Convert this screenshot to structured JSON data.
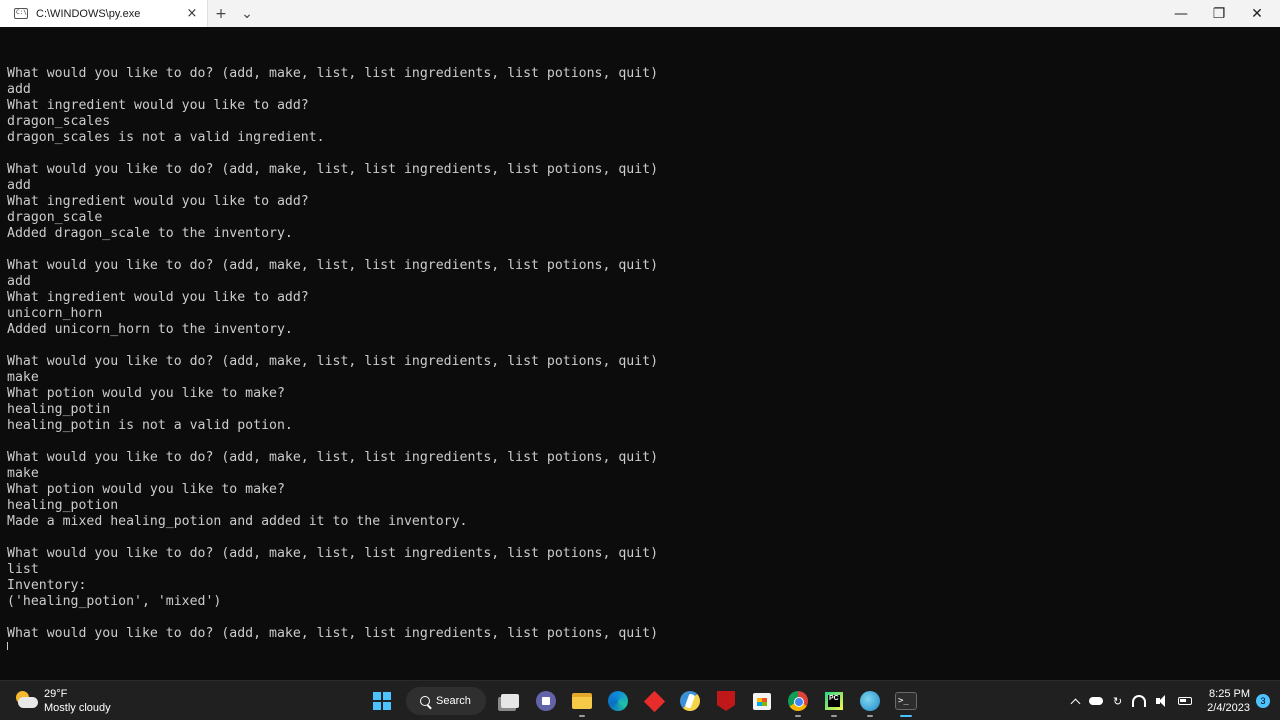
{
  "window": {
    "tab_title": "C:\\WINDOWS\\py.exe",
    "tab_icon_text": "C:\\",
    "close_tab": "×",
    "new_tab": "+",
    "dropdown": "⌄",
    "minimize": "—",
    "maximize": "❐",
    "close": "✕"
  },
  "terminal": {
    "lines": [
      "",
      "What would you like to do? (add, make, list, list ingredients, list potions, quit)",
      "add",
      "What ingredient would you like to add?",
      "dragon_scales",
      "dragon_scales is not a valid ingredient.",
      "",
      "What would you like to do? (add, make, list, list ingredients, list potions, quit)",
      "add",
      "What ingredient would you like to add?",
      "dragon_scale",
      "Added dragon_scale to the inventory.",
      "",
      "What would you like to do? (add, make, list, list ingredients, list potions, quit)",
      "add",
      "What ingredient would you like to add?",
      "unicorn_horn",
      "Added unicorn_horn to the inventory.",
      "",
      "What would you like to do? (add, make, list, list ingredients, list potions, quit)",
      "make",
      "What potion would you like to make?",
      "healing_potin",
      "healing_potin is not a valid potion.",
      "",
      "What would you like to do? (add, make, list, list ingredients, list potions, quit)",
      "make",
      "What potion would you like to make?",
      "healing_potion",
      "Made a mixed healing_potion and added it to the inventory.",
      "",
      "What would you like to do? (add, make, list, list ingredients, list potions, quit)",
      "list",
      "Inventory:",
      "('healing_potion', 'mixed')",
      "",
      "What would you like to do? (add, make, list, list ingredients, list potions, quit)"
    ]
  },
  "taskbar": {
    "weather_temp": "29°F",
    "weather_desc": "Mostly cloudy",
    "search_label": "Search",
    "time": "8:25 PM",
    "date": "2/4/2023",
    "notification_count": "3",
    "icons": [
      "windows-icon",
      "search-icon",
      "task-view-icon",
      "teams-icon",
      "file-explorer-icon",
      "edge-icon",
      "red-diamond-app-icon",
      "python-icon",
      "mcafee-icon",
      "store-icon",
      "chrome-icon",
      "pycharm-icon",
      "globe-app-icon",
      "terminal-icon"
    ],
    "pycharm_text": "PC",
    "terminal_icon_text": ">_"
  },
  "colors": {
    "terminal_bg": "#0c0c0c",
    "terminal_fg": "#cccccc",
    "taskbar_bg": "#202020",
    "accent": "#4cc2ff"
  }
}
